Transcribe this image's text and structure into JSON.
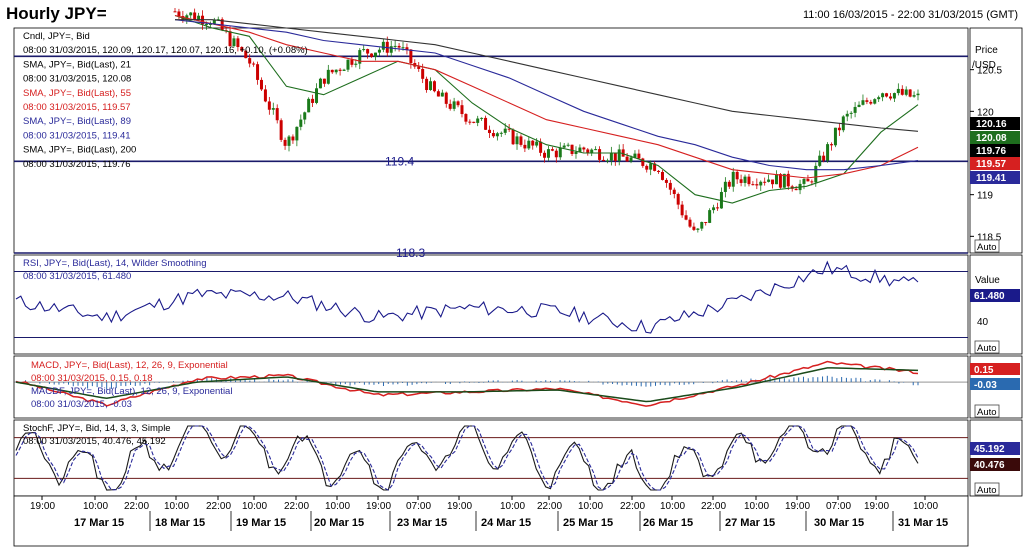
{
  "header": {
    "title": "Hourly JPY=",
    "date_range": "11:00 16/03/2015 - 22:00 31/03/2015 (GMT)"
  },
  "colors": {
    "candle_up": "#1a7a1a",
    "candle_down": "#cc0000",
    "sma21": "#1e6e1e",
    "sma55": "#d62020",
    "sma89": "#2a2a9a",
    "sma200": "#333333",
    "rsi": "#1a1a8a",
    "macd": "#d62020",
    "macdf": "#1a4a1a",
    "hist": "#2a6ab0",
    "stoch_k": "#1a1a1a",
    "stoch_d": "#2a2a9a"
  },
  "panels": {
    "price": {
      "legend": [
        {
          "text": "Cndl, JPY=, Bid",
          "color": "#000000"
        },
        {
          "text": "08:00 31/03/2015, 120.09, 120.17, 120.07, 120.16, +0.10, (+0.08%)",
          "color": "#000000",
          "accent": "#2a2ad0"
        },
        {
          "text": "SMA, JPY=, Bid(Last), 21",
          "color": "#000000"
        },
        {
          "text": "08:00 31/03/2015, 120.08",
          "color": "#000000"
        },
        {
          "text": "SMA, JPY=, Bid(Last), 55",
          "color": "#d62020"
        },
        {
          "text": "08:00 31/03/2015, 119.57",
          "color": "#d62020"
        },
        {
          "text": "SMA, JPY=, Bid(Last), 89",
          "color": "#2a2a9a"
        },
        {
          "text": "08:00 31/03/2015, 119.41",
          "color": "#2a2a9a"
        },
        {
          "text": "SMA, JPY=, Bid(Last), 200",
          "color": "#000000"
        },
        {
          "text": "08:00 31/03/2015, 119.76",
          "color": "#000000"
        }
      ],
      "axis_title": "Price",
      "axis_unit": "/USD",
      "ticks": [
        "120.5",
        "120",
        "119.5",
        "119",
        "118.5"
      ],
      "tick_values": [
        120.5,
        120.0,
        119.5,
        119.0,
        118.5
      ],
      "ylim": [
        118.3,
        121.0
      ],
      "levels": [
        {
          "label": "119.4",
          "value": 119.4
        },
        {
          "label": "118.3",
          "value": 118.3
        },
        {
          "label": "",
          "value": 120.66
        }
      ],
      "tags": [
        {
          "text": "120.16",
          "value": 120.16,
          "bg": "#000000",
          "fg": "#ffffff"
        },
        {
          "text": "120.08",
          "value": 120.08,
          "bg": "#1e6e1e",
          "fg": "#ffffff"
        },
        {
          "text": "119.76",
          "value": 119.76,
          "bg": "#000000",
          "fg": "#ffffff"
        },
        {
          "text": "119.57",
          "value": 119.57,
          "bg": "#d62020",
          "fg": "#ffffff"
        },
        {
          "text": "119.41",
          "value": 119.41,
          "bg": "#2a2a9a",
          "fg": "#ffffff"
        }
      ],
      "auto": "Auto"
    },
    "rsi": {
      "legend": [
        {
          "text": "RSI, JPY=, Bid(Last), 14, Wilder Smoothing",
          "color": "#2a2a9a"
        },
        {
          "text": "08:00 31/03/2015, 61.480",
          "color": "#2a2a9a"
        }
      ],
      "axis_title": "Value",
      "ticks": [
        "40"
      ],
      "tick_values": [
        40
      ],
      "ylim": [
        20,
        80
      ],
      "levels": [
        70,
        30
      ],
      "tag": {
        "text": "61.480",
        "value": 61.48
      },
      "auto": "Auto"
    },
    "macd": {
      "legend": [
        {
          "text": "MACD, JPY=, Bid(Last), 12, 26, 9, Exponential",
          "color": "#d62020"
        },
        {
          "text": "08:00 31/03/2015, 0.15, 0.18",
          "color": "#d62020"
        },
        {
          "text": "MACDF, JPY=, Bid(Last), 12, 26, 9, Exponential",
          "color": "#2a2a9a"
        },
        {
          "text": "08:00 31/03/2015, -0.03",
          "color": "#2a2a9a"
        }
      ],
      "tags": [
        {
          "text": "0.15",
          "value": 0.15,
          "bg": "#d62020",
          "fg": "#ffffff"
        },
        {
          "text": "-0.03",
          "value": -0.03,
          "bg": "#2a6ab0",
          "fg": "#ffffff"
        }
      ],
      "ylim": [
        -0.55,
        0.4
      ],
      "auto": "Auto"
    },
    "stoch": {
      "legend": [
        {
          "text": "StochF, JPY=, Bid, 14, 3, 3, Simple",
          "color": "#000000"
        },
        {
          "text": "08:00 31/03/2015, 40.476, 45.192",
          "color": "#000000"
        }
      ],
      "tags": [
        {
          "text": "45.192",
          "value": 45.192,
          "bg": "#2a2a9a",
          "fg": "#ffffff"
        },
        {
          "text": "40.476",
          "value": 40.476,
          "bg": "#3a0a0a",
          "fg": "#ffffff"
        }
      ],
      "ylim": [
        0,
        100
      ],
      "levels": [
        80,
        20
      ],
      "auto": "Auto"
    }
  },
  "time_axis": {
    "hours": [
      "19:00",
      "10:00",
      "22:00",
      "10:00",
      "22:00",
      "10:00",
      "22:00",
      "10:00",
      "19:00",
      "07:00",
      "19:00",
      "10:00",
      "22:00",
      "10:00",
      "22:00",
      "10:00",
      "22:00",
      "10:00",
      "19:00",
      "07:00",
      "19:00",
      "10:00"
    ],
    "dates": [
      "17 Mar 15",
      "18 Mar 15",
      "19 Mar 15",
      "20 Mar 15",
      "23 Mar 15",
      "24 Mar 15",
      "25 Mar 15",
      "26 Mar 15",
      "27 Mar 15",
      "30 Mar 15",
      "31 Mar 15"
    ]
  },
  "chart_data": [
    {
      "type": "candlestick",
      "title": "Hourly JPY=",
      "ylabel": "Price /USD",
      "ylim": [
        118.3,
        121.0
      ],
      "x": [
        "17 Mar",
        "17 Mar",
        "18 Mar",
        "18 Mar",
        "19 Mar",
        "19 Mar",
        "20 Mar",
        "20 Mar",
        "23 Mar",
        "23 Mar",
        "24 Mar",
        "24 Mar",
        "25 Mar",
        "25 Mar",
        "26 Mar",
        "26 Mar",
        "27 Mar",
        "27 Mar",
        "30 Mar",
        "30 Mar",
        "31 Mar"
      ],
      "close": [
        121.2,
        121.1,
        120.6,
        119.6,
        120.4,
        120.7,
        120.8,
        120.2,
        119.9,
        119.7,
        119.5,
        119.55,
        119.45,
        119.35,
        118.5,
        119.2,
        119.2,
        119.1,
        119.9,
        120.25,
        120.16
      ],
      "series": [
        {
          "name": "SMA, JPY=, Bid(Last), 21",
          "values": [
            121.15,
            121.0,
            120.9,
            120.3,
            120.2,
            120.4,
            120.6,
            120.5,
            120.1,
            119.8,
            119.6,
            119.5,
            119.5,
            119.35,
            119.0,
            118.9,
            119.05,
            119.1,
            119.25,
            119.75,
            120.08
          ]
        },
        {
          "name": "SMA, JPY=, Bid(Last), 55",
          "values": [
            121.15,
            121.05,
            120.95,
            120.8,
            120.7,
            120.6,
            120.6,
            120.5,
            120.3,
            120.1,
            119.9,
            119.8,
            119.7,
            119.6,
            119.45,
            119.3,
            119.25,
            119.2,
            119.25,
            119.35,
            119.57
          ]
        },
        {
          "name": "SMA, JPY=, Bid(Last), 89",
          "values": [
            121.1,
            121.05,
            121.0,
            120.95,
            120.85,
            120.8,
            120.75,
            120.7,
            120.55,
            120.4,
            120.2,
            120.0,
            119.85,
            119.7,
            119.6,
            119.45,
            119.35,
            119.3,
            119.3,
            119.35,
            119.41
          ]
        },
        {
          "name": "SMA, JPY=, Bid(Last), 200",
          "values": [
            121.1,
            121.1,
            121.05,
            121.0,
            120.95,
            120.9,
            120.85,
            120.8,
            120.7,
            120.6,
            120.5,
            120.4,
            120.3,
            120.2,
            120.1,
            120.0,
            119.95,
            119.9,
            119.85,
            119.8,
            119.76
          ]
        }
      ]
    },
    {
      "type": "line",
      "title": "RSI, JPY=, Bid(Last), 14, Wilder Smoothing",
      "ylim": [
        20,
        80
      ],
      "x": [
        "17 Mar",
        "18 Mar",
        "19 Mar",
        "20 Mar",
        "23 Mar",
        "24 Mar",
        "25 Mar",
        "26 Mar",
        "27 Mar",
        "30 Mar",
        "31 Mar"
      ],
      "series": [
        {
          "name": "RSI, JPY=, Bid(Last), 14, Wilder Smoothing",
          "values": [
            52,
            42,
            56,
            55,
            42,
            48,
            46,
            36,
            52,
            72,
            61.48
          ]
        }
      ]
    },
    {
      "type": "line",
      "title": "MACD, JPY=, Bid(Last), 12, 26, 9, Exponential",
      "ylim": [
        -0.55,
        0.4
      ],
      "x": [
        "17 Mar",
        "18 Mar",
        "19 Mar",
        "20 Mar",
        "23 Mar",
        "24 Mar",
        "25 Mar",
        "26 Mar",
        "27 Mar",
        "30 Mar",
        "31 Mar"
      ],
      "series": [
        {
          "name": "MACD, JPY=, Bid(Last), 12, 26, 9, Exponential",
          "values": [
            0.02,
            -0.35,
            0.05,
            0.1,
            -0.2,
            -0.15,
            -0.1,
            -0.35,
            -0.05,
            0.3,
            0.15
          ]
        },
        {
          "name": "MACDF, JPY=, Bid(Last), 12, 26, 9, Exponential",
          "values": [
            0.0,
            -0.25,
            0.0,
            0.08,
            -0.15,
            -0.15,
            -0.12,
            -0.3,
            -0.08,
            0.22,
            0.18
          ]
        }
      ]
    },
    {
      "type": "line",
      "title": "StochF, JPY=, Bid, 14, 3, 3, Simple",
      "ylim": [
        0,
        100
      ],
      "x": [
        "17 Mar",
        "18 Mar",
        "19 Mar",
        "20 Mar",
        "23 Mar",
        "24 Mar",
        "25 Mar",
        "26 Mar",
        "27 Mar",
        "30 Mar",
        "31 Mar"
      ],
      "series": [
        {
          "name": "StochF, JPY=, Bid, 14, 3, 3, Simple",
          "values": [
            70,
            20,
            85,
            60,
            30,
            75,
            40,
            20,
            60,
            85,
            40.476
          ]
        }
      ]
    }
  ]
}
